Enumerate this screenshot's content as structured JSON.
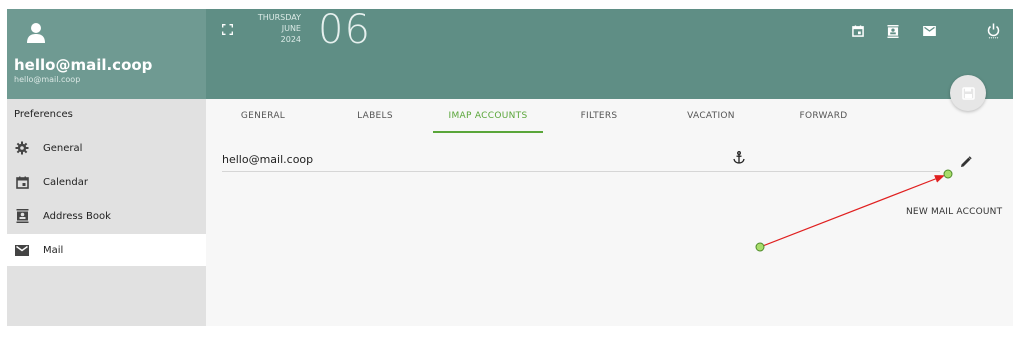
{
  "account": {
    "name": "hello@mail.coop",
    "email": "hello@mail.coop"
  },
  "header": {
    "weekday": "THURSDAY",
    "month": "JUNE",
    "year": "2024",
    "day": "06",
    "icons": [
      "calendar-icon",
      "address-book-icon",
      "mail-icon",
      "power-icon"
    ]
  },
  "sidebar": {
    "title": "Preferences",
    "items": [
      {
        "label": "General",
        "icon": "gear-icon"
      },
      {
        "label": "Calendar",
        "icon": "calendar-icon"
      },
      {
        "label": "Address Book",
        "icon": "address-book-icon"
      },
      {
        "label": "Mail",
        "icon": "mail-icon",
        "active": true
      }
    ]
  },
  "tabs": [
    {
      "label": "GENERAL"
    },
    {
      "label": "LABELS"
    },
    {
      "label": "IMAP ACCOUNTS",
      "active": true
    },
    {
      "label": "FILTERS"
    },
    {
      "label": "VACATION"
    },
    {
      "label": "FORWARD"
    }
  ],
  "content": {
    "account_row": "hello@mail.coop",
    "new_account_label": "NEW MAIL ACCOUNT"
  },
  "colors": {
    "header_bg": "#5f8e85",
    "account_bg": "#6f9a92",
    "accent": "#5aa63a",
    "annotation_arrow": "#e02020"
  }
}
